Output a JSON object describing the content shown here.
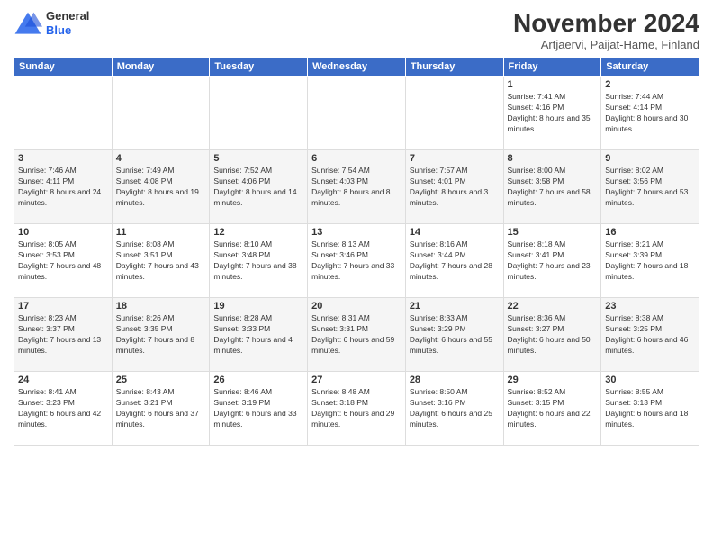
{
  "logo": {
    "general": "General",
    "blue": "Blue"
  },
  "title": "November 2024",
  "location": "Artjaervi, Paijat-Hame, Finland",
  "days_header": [
    "Sunday",
    "Monday",
    "Tuesday",
    "Wednesday",
    "Thursday",
    "Friday",
    "Saturday"
  ],
  "weeks": [
    [
      {
        "day": "",
        "sunrise": "",
        "sunset": "",
        "daylight": ""
      },
      {
        "day": "",
        "sunrise": "",
        "sunset": "",
        "daylight": ""
      },
      {
        "day": "",
        "sunrise": "",
        "sunset": "",
        "daylight": ""
      },
      {
        "day": "",
        "sunrise": "",
        "sunset": "",
        "daylight": ""
      },
      {
        "day": "",
        "sunrise": "",
        "sunset": "",
        "daylight": ""
      },
      {
        "day": "1",
        "sunrise": "Sunrise: 7:41 AM",
        "sunset": "Sunset: 4:16 PM",
        "daylight": "Daylight: 8 hours and 35 minutes."
      },
      {
        "day": "2",
        "sunrise": "Sunrise: 7:44 AM",
        "sunset": "Sunset: 4:14 PM",
        "daylight": "Daylight: 8 hours and 30 minutes."
      }
    ],
    [
      {
        "day": "3",
        "sunrise": "Sunrise: 7:46 AM",
        "sunset": "Sunset: 4:11 PM",
        "daylight": "Daylight: 8 hours and 24 minutes."
      },
      {
        "day": "4",
        "sunrise": "Sunrise: 7:49 AM",
        "sunset": "Sunset: 4:08 PM",
        "daylight": "Daylight: 8 hours and 19 minutes."
      },
      {
        "day": "5",
        "sunrise": "Sunrise: 7:52 AM",
        "sunset": "Sunset: 4:06 PM",
        "daylight": "Daylight: 8 hours and 14 minutes."
      },
      {
        "day": "6",
        "sunrise": "Sunrise: 7:54 AM",
        "sunset": "Sunset: 4:03 PM",
        "daylight": "Daylight: 8 hours and 8 minutes."
      },
      {
        "day": "7",
        "sunrise": "Sunrise: 7:57 AM",
        "sunset": "Sunset: 4:01 PM",
        "daylight": "Daylight: 8 hours and 3 minutes."
      },
      {
        "day": "8",
        "sunrise": "Sunrise: 8:00 AM",
        "sunset": "Sunset: 3:58 PM",
        "daylight": "Daylight: 7 hours and 58 minutes."
      },
      {
        "day": "9",
        "sunrise": "Sunrise: 8:02 AM",
        "sunset": "Sunset: 3:56 PM",
        "daylight": "Daylight: 7 hours and 53 minutes."
      }
    ],
    [
      {
        "day": "10",
        "sunrise": "Sunrise: 8:05 AM",
        "sunset": "Sunset: 3:53 PM",
        "daylight": "Daylight: 7 hours and 48 minutes."
      },
      {
        "day": "11",
        "sunrise": "Sunrise: 8:08 AM",
        "sunset": "Sunset: 3:51 PM",
        "daylight": "Daylight: 7 hours and 43 minutes."
      },
      {
        "day": "12",
        "sunrise": "Sunrise: 8:10 AM",
        "sunset": "Sunset: 3:48 PM",
        "daylight": "Daylight: 7 hours and 38 minutes."
      },
      {
        "day": "13",
        "sunrise": "Sunrise: 8:13 AM",
        "sunset": "Sunset: 3:46 PM",
        "daylight": "Daylight: 7 hours and 33 minutes."
      },
      {
        "day": "14",
        "sunrise": "Sunrise: 8:16 AM",
        "sunset": "Sunset: 3:44 PM",
        "daylight": "Daylight: 7 hours and 28 minutes."
      },
      {
        "day": "15",
        "sunrise": "Sunrise: 8:18 AM",
        "sunset": "Sunset: 3:41 PM",
        "daylight": "Daylight: 7 hours and 23 minutes."
      },
      {
        "day": "16",
        "sunrise": "Sunrise: 8:21 AM",
        "sunset": "Sunset: 3:39 PM",
        "daylight": "Daylight: 7 hours and 18 minutes."
      }
    ],
    [
      {
        "day": "17",
        "sunrise": "Sunrise: 8:23 AM",
        "sunset": "Sunset: 3:37 PM",
        "daylight": "Daylight: 7 hours and 13 minutes."
      },
      {
        "day": "18",
        "sunrise": "Sunrise: 8:26 AM",
        "sunset": "Sunset: 3:35 PM",
        "daylight": "Daylight: 7 hours and 8 minutes."
      },
      {
        "day": "19",
        "sunrise": "Sunrise: 8:28 AM",
        "sunset": "Sunset: 3:33 PM",
        "daylight": "Daylight: 7 hours and 4 minutes."
      },
      {
        "day": "20",
        "sunrise": "Sunrise: 8:31 AM",
        "sunset": "Sunset: 3:31 PM",
        "daylight": "Daylight: 6 hours and 59 minutes."
      },
      {
        "day": "21",
        "sunrise": "Sunrise: 8:33 AM",
        "sunset": "Sunset: 3:29 PM",
        "daylight": "Daylight: 6 hours and 55 minutes."
      },
      {
        "day": "22",
        "sunrise": "Sunrise: 8:36 AM",
        "sunset": "Sunset: 3:27 PM",
        "daylight": "Daylight: 6 hours and 50 minutes."
      },
      {
        "day": "23",
        "sunrise": "Sunrise: 8:38 AM",
        "sunset": "Sunset: 3:25 PM",
        "daylight": "Daylight: 6 hours and 46 minutes."
      }
    ],
    [
      {
        "day": "24",
        "sunrise": "Sunrise: 8:41 AM",
        "sunset": "Sunset: 3:23 PM",
        "daylight": "Daylight: 6 hours and 42 minutes."
      },
      {
        "day": "25",
        "sunrise": "Sunrise: 8:43 AM",
        "sunset": "Sunset: 3:21 PM",
        "daylight": "Daylight: 6 hours and 37 minutes."
      },
      {
        "day": "26",
        "sunrise": "Sunrise: 8:46 AM",
        "sunset": "Sunset: 3:19 PM",
        "daylight": "Daylight: 6 hours and 33 minutes."
      },
      {
        "day": "27",
        "sunrise": "Sunrise: 8:48 AM",
        "sunset": "Sunset: 3:18 PM",
        "daylight": "Daylight: 6 hours and 29 minutes."
      },
      {
        "day": "28",
        "sunrise": "Sunrise: 8:50 AM",
        "sunset": "Sunset: 3:16 PM",
        "daylight": "Daylight: 6 hours and 25 minutes."
      },
      {
        "day": "29",
        "sunrise": "Sunrise: 8:52 AM",
        "sunset": "Sunset: 3:15 PM",
        "daylight": "Daylight: 6 hours and 22 minutes."
      },
      {
        "day": "30",
        "sunrise": "Sunrise: 8:55 AM",
        "sunset": "Sunset: 3:13 PM",
        "daylight": "Daylight: 6 hours and 18 minutes."
      }
    ]
  ]
}
